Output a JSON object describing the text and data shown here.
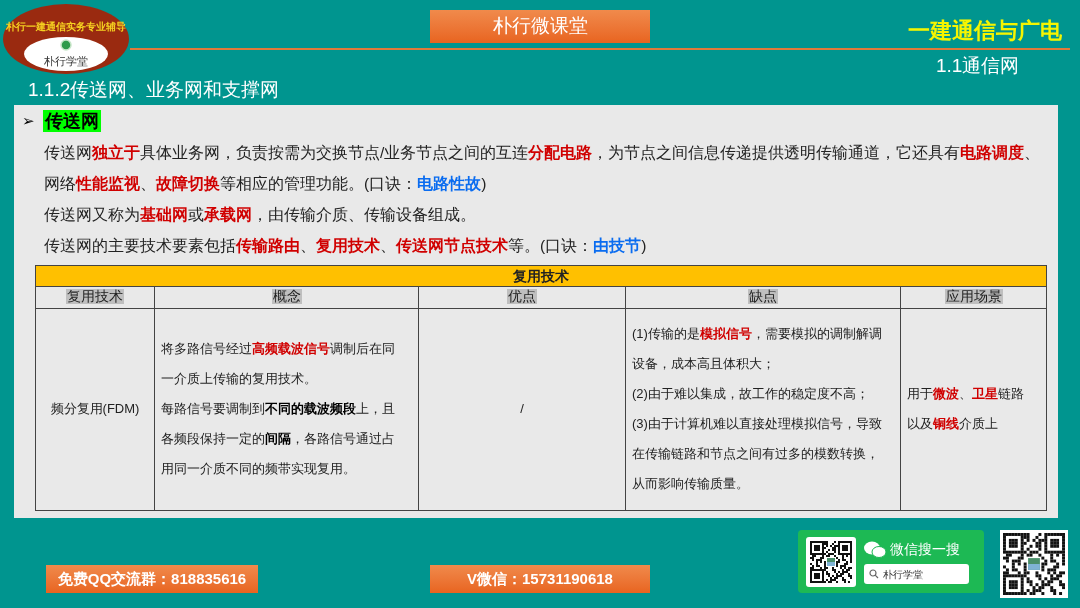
{
  "logo": {
    "ring_text": "朴行一建通信实务专业辅导",
    "name": "朴行学堂"
  },
  "header": {
    "banner": "朴行微课堂",
    "subject": "一建通信与广电",
    "chapter": "1.1通信网"
  },
  "section_title": "1.1.2传送网、业务网和支撑网",
  "topic": {
    "bullet": "➢",
    "heading": "传送网"
  },
  "paragraphs": [
    [
      {
        "text": "传送网",
        "kind": "plain"
      },
      {
        "text": "独立于",
        "kind": "key"
      },
      {
        "text": "具体业务网，负责按需为交换节点/业务节点之间的互连",
        "kind": "plain"
      },
      {
        "text": "分配电路",
        "kind": "key"
      },
      {
        "text": "，为节点之间信息传递提供透明传输通道，它还具有",
        "kind": "plain"
      },
      {
        "text": "电路调度",
        "kind": "key"
      },
      {
        "text": "、网络",
        "kind": "plain"
      },
      {
        "text": "性能监视",
        "kind": "key"
      },
      {
        "text": "、",
        "kind": "plain"
      },
      {
        "text": "故障切换",
        "kind": "key"
      },
      {
        "text": "等相应的管理功能。(口诀：",
        "kind": "plain"
      },
      {
        "text": "电路性故",
        "kind": "mnemonic"
      },
      {
        "text": ")",
        "kind": "plain"
      }
    ],
    [
      {
        "text": "传送网又称为",
        "kind": "plain"
      },
      {
        "text": "基础网",
        "kind": "key"
      },
      {
        "text": "或",
        "kind": "plain"
      },
      {
        "text": "承载网",
        "kind": "key"
      },
      {
        "text": "，由传输介质、传输设备组成。",
        "kind": "plain"
      }
    ],
    [
      {
        "text": "传送网的主要技术要素包括",
        "kind": "plain"
      },
      {
        "text": "传输路由",
        "kind": "key"
      },
      {
        "text": "、",
        "kind": "plain"
      },
      {
        "text": "复用技术",
        "kind": "key"
      },
      {
        "text": "、",
        "kind": "plain"
      },
      {
        "text": "传送网节点技术",
        "kind": "key"
      },
      {
        "text": "等。(口诀：",
        "kind": "plain"
      },
      {
        "text": "由技节",
        "kind": "mnemonic"
      },
      {
        "text": ")",
        "kind": "plain"
      }
    ]
  ],
  "table": {
    "title": "复用技术",
    "columns": [
      "复用技术",
      "概念",
      "优点",
      "缺点",
      "应用场景"
    ],
    "rows": [
      {
        "cells": [
          [
            [
              {
                "text": "频分复用(FDM)",
                "kind": "plain"
              }
            ]
          ],
          [
            [
              {
                "text": "将多路信号经过",
                "kind": "plain"
              },
              {
                "text": "高频载波信号",
                "kind": "key"
              },
              {
                "text": "调制后在同一介质上传输的复用技术。",
                "kind": "plain"
              }
            ],
            [
              {
                "text": "每路信号要调制到",
                "kind": "plain"
              },
              {
                "text": "不同的载波频段",
                "kind": "bold"
              },
              {
                "text": "上，且各频段保持一定的",
                "kind": "plain"
              },
              {
                "text": "间隔",
                "kind": "bold"
              },
              {
                "text": "，各路信号通过占用同一介质不同的频带实现复用。",
                "kind": "plain"
              }
            ]
          ],
          [
            [
              {
                "text": "/",
                "kind": "plain"
              }
            ]
          ],
          [
            [
              {
                "text": "(1)传输的是",
                "kind": "plain"
              },
              {
                "text": "模拟信号",
                "kind": "key"
              },
              {
                "text": "，需要模拟的调制解调设备，成本高且体积大；",
                "kind": "plain"
              }
            ],
            [
              {
                "text": "(2)由于难以集成，故工作的稳定度不高；",
                "kind": "plain"
              }
            ],
            [
              {
                "text": "(3)由于计算机难以直接处理模拟信号，导致在传输链路和节点之间有过多的模数转换，从而影响传输质量。",
                "kind": "plain"
              }
            ]
          ],
          [
            [
              {
                "text": "用于",
                "kind": "plain"
              },
              {
                "text": "微波",
                "kind": "key"
              },
              {
                "text": "、",
                "kind": "plain"
              },
              {
                "text": "卫星",
                "kind": "key"
              },
              {
                "text": "链路以及",
                "kind": "plain"
              },
              {
                "text": "铜线",
                "kind": "key"
              },
              {
                "text": "介质上",
                "kind": "plain"
              }
            ]
          ]
        ]
      }
    ]
  },
  "footer": {
    "qq_group": "免费QQ交流群：818835616",
    "wechat": "V微信：15731190618",
    "search_card": {
      "label": "微信搜一搜",
      "query": "朴行学堂"
    }
  }
}
